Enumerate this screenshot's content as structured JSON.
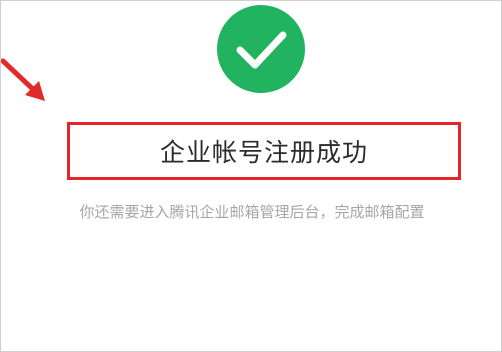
{
  "dialog": {
    "title": "企业帐号注册成功",
    "subtitle": "你还需要进入腾讯企业邮箱管理后台，完成邮箱配置"
  },
  "icons": {
    "status": "check-circle-icon",
    "pointer": "red-arrow-icon"
  },
  "colors": {
    "success": "#21b35f",
    "highlight": "#e2262c",
    "arrow": "#e32a2a",
    "title_text": "#2b2b2b",
    "subtitle_text": "#a6a6a6"
  }
}
